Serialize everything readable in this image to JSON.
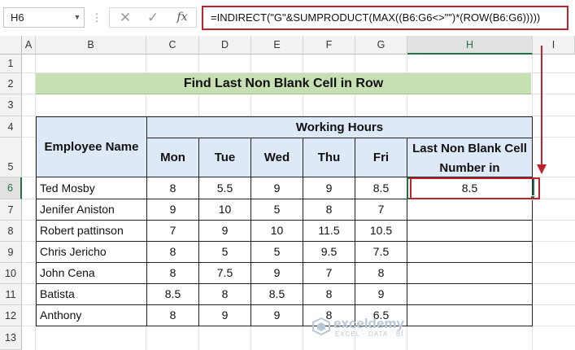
{
  "formula_bar": {
    "name_box": "H6",
    "formula": "=INDIRECT(\"G\"&SUMPRODUCT(MAX((B6:G6<>\"\")*(ROW(B6:G6)))))",
    "fx_label": "fx",
    "cancel_glyph": "✕",
    "enter_glyph": "✓",
    "dots_glyph": "⋮"
  },
  "columns": [
    "A",
    "B",
    "C",
    "D",
    "E",
    "F",
    "G",
    "H",
    "I"
  ],
  "rows": [
    "1",
    "2",
    "3",
    "4",
    "5",
    "6",
    "7",
    "8",
    "9",
    "10",
    "11",
    "12",
    "13"
  ],
  "sheet": {
    "title": "Find Last Non Blank Cell in Row",
    "header_name": "Employee Name",
    "header_group": "Working Hours",
    "days": [
      "Mon",
      "Tue",
      "Wed",
      "Thu",
      "Fri"
    ],
    "result_header": "Last Non Blank Cell Number in",
    "employees": [
      {
        "name": "Ted Mosby",
        "mon": "8",
        "tue": "5.5",
        "wed": "9",
        "thu": "9",
        "fri": "8.5",
        "result": "8.5"
      },
      {
        "name": "Jenifer Aniston",
        "mon": "9",
        "tue": "10",
        "wed": "5",
        "thu": "8",
        "fri": "7",
        "result": ""
      },
      {
        "name": "Robert pattinson",
        "mon": "7",
        "tue": "9",
        "wed": "10",
        "thu": "11.5",
        "fri": "10.5",
        "result": ""
      },
      {
        "name": "Chris Jericho",
        "mon": "8",
        "tue": "5",
        "wed": "5",
        "thu": "9.5",
        "fri": "7.5",
        "result": ""
      },
      {
        "name": "John Cena",
        "mon": "8",
        "tue": "7.5",
        "wed": "9",
        "thu": "7",
        "fri": "8",
        "result": ""
      },
      {
        "name": "Batista",
        "mon": "8.5",
        "tue": "8",
        "wed": "8.5",
        "thu": "8",
        "fri": "9",
        "result": ""
      },
      {
        "name": "Anthony",
        "mon": "8",
        "tue": "9",
        "wed": "9",
        "thu": "8",
        "fri": "6.5",
        "result": ""
      }
    ]
  },
  "watermark": {
    "name": "exceldemy",
    "tagline": "EXCEL · DATA · BI"
  },
  "colors": {
    "accent_red": "#c0232c",
    "excel_green": "#217346",
    "title_fill": "#c6e0b4",
    "header_fill": "#dde9f7"
  }
}
